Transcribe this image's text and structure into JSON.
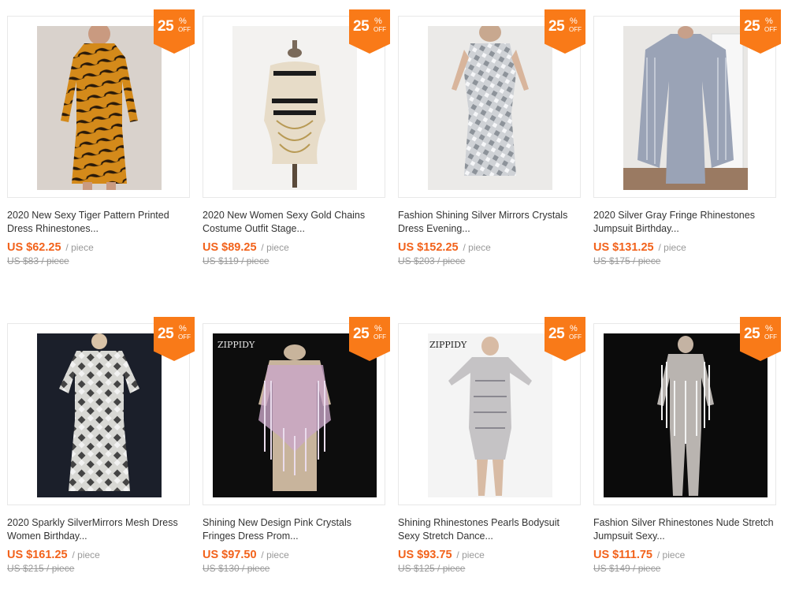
{
  "products": [
    {
      "title": "2020 New Sexy Tiger Pattern Printed Dress Rhinestones...",
      "price": "US $62.25",
      "unit": "/ piece",
      "original": "US $83 / piece",
      "discount": "25",
      "percent": "%",
      "off": "OFF"
    },
    {
      "title": "2020 New Women Sexy Gold Chains Costume Outfit Stage...",
      "price": "US $89.25",
      "unit": "/ piece",
      "original": "US $119 / piece",
      "discount": "25",
      "percent": "%",
      "off": "OFF"
    },
    {
      "title": "Fashion Shining Silver Mirrors Crystals Dress Evening...",
      "price": "US $152.25",
      "unit": "/ piece",
      "original": "US $203 / piece",
      "discount": "25",
      "percent": "%",
      "off": "OFF"
    },
    {
      "title": "2020 Silver Gray Fringe Rhinestones Jumpsuit Birthday...",
      "price": "US $131.25",
      "unit": "/ piece",
      "original": "US $175 / piece",
      "discount": "25",
      "percent": "%",
      "off": "OFF"
    },
    {
      "title": "2020 Sparkly SilverMirrors Mesh Dress Women Birthday...",
      "price": "US $161.25",
      "unit": "/ piece",
      "original": "US $215 / piece",
      "discount": "25",
      "percent": "%",
      "off": "OFF"
    },
    {
      "title": "Shining New Design Pink Crystals Fringes Dress Prom...",
      "price": "US $97.50",
      "unit": "/ piece",
      "original": "US $130 / piece",
      "discount": "25",
      "percent": "%",
      "off": "OFF",
      "brand": "ZIPPIDY"
    },
    {
      "title": "Shining Rhinestones Pearls Bodysuit Sexy Stretch Dance...",
      "price": "US $93.75",
      "unit": "/ piece",
      "original": "US $125 / piece",
      "discount": "25",
      "percent": "%",
      "off": "OFF",
      "brand": "ZIPPIDY"
    },
    {
      "title": "Fashion Silver Rhinestones Nude Stretch Jumpsuit Sexy...",
      "price": "US $111.75",
      "unit": "/ piece",
      "original": "US $149 / piece",
      "discount": "25",
      "percent": "%",
      "off": "OFF"
    }
  ],
  "colors": {
    "accent": "#f97a18",
    "price": "#f2621b",
    "muted": "#999999"
  }
}
